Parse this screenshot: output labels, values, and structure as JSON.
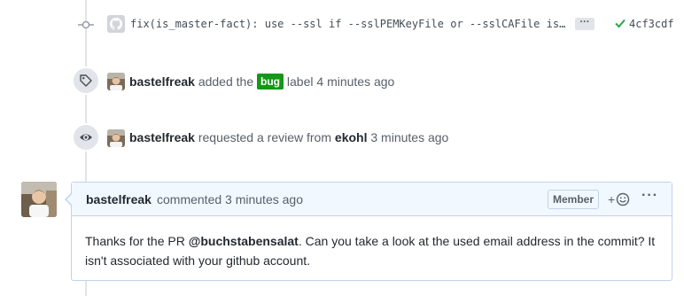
{
  "commit": {
    "message": "fix(is_master-fact): use --ssl if --sslPEMKeyFile or --sslCAFile is s…",
    "expand_label": "···",
    "sha": "4cf3cdf",
    "status_color": "#28a745"
  },
  "events": [
    {
      "actor": "bastelfreak",
      "action": "added the",
      "label": "bug",
      "label_color": "#159818",
      "suffix": "label",
      "time": "4 minutes ago",
      "icon": "tag-icon"
    },
    {
      "actor": "bastelfreak",
      "action": "requested a review from",
      "target": "ekohl",
      "time": "3 minutes ago",
      "icon": "eye-icon"
    }
  ],
  "comment": {
    "author": "bastelfreak",
    "meta": "commented 3 minutes ago",
    "badge": "Member",
    "reaction_label": "+",
    "more_label": "···",
    "body_before": "Thanks for the PR ",
    "mention": "@buchstabensalat",
    "body_after": ". Can you take a look at the used email address in the commit? It isn't associated with your github account."
  }
}
